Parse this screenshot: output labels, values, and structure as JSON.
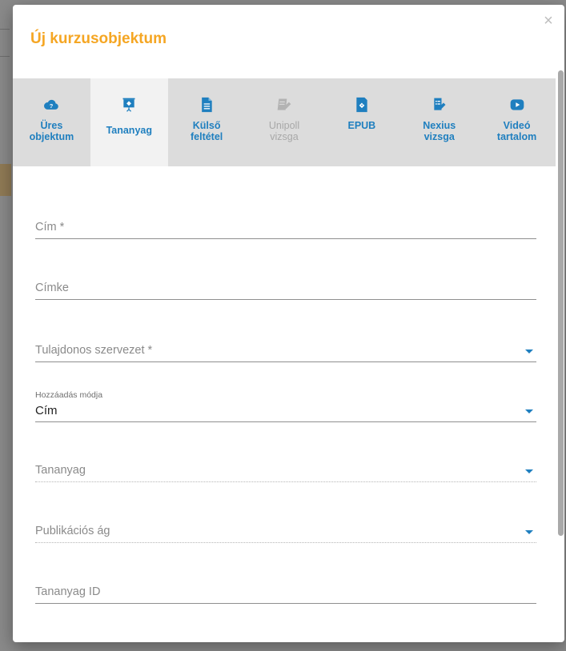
{
  "dialog": {
    "title": "Új kurzusobjektum",
    "close_label": "×"
  },
  "tabs": [
    {
      "label": "Üres\nobjektum",
      "icon": "cloud-question-icon",
      "active": false,
      "disabled": false
    },
    {
      "label": "Tananyag",
      "icon": "presentation-board-icon",
      "active": true,
      "disabled": false
    },
    {
      "label": "Külső\nfeltétel",
      "icon": "document-icon",
      "active": false,
      "disabled": false
    },
    {
      "label": "Unipoll\nvizsga",
      "icon": "notepad-pen-icon",
      "active": false,
      "disabled": true
    },
    {
      "label": "EPUB",
      "icon": "epub-book-icon",
      "active": false,
      "disabled": false
    },
    {
      "label": "Nexius\nvizsga",
      "icon": "checklist-pen-icon",
      "active": false,
      "disabled": false
    },
    {
      "label": "Videó\ntartalom",
      "icon": "play-icon",
      "active": false,
      "disabled": false
    }
  ],
  "form": {
    "title_placeholder": "Cím *",
    "label_placeholder": "Címke",
    "owner_org_placeholder": "Tulajdonos szervezet *",
    "add_mode_label": "Hozzáadás módja",
    "add_mode_value": "Cím",
    "material_placeholder": "Tananyag",
    "publication_branch_placeholder": "Publikációs ág",
    "material_id_placeholder": "Tananyag ID"
  },
  "colors": {
    "accent": "#f5a623",
    "tab_text": "#1f7fbf",
    "tab_disabled": "#a8a8a8",
    "tab_bar": "#dcdcdc"
  }
}
